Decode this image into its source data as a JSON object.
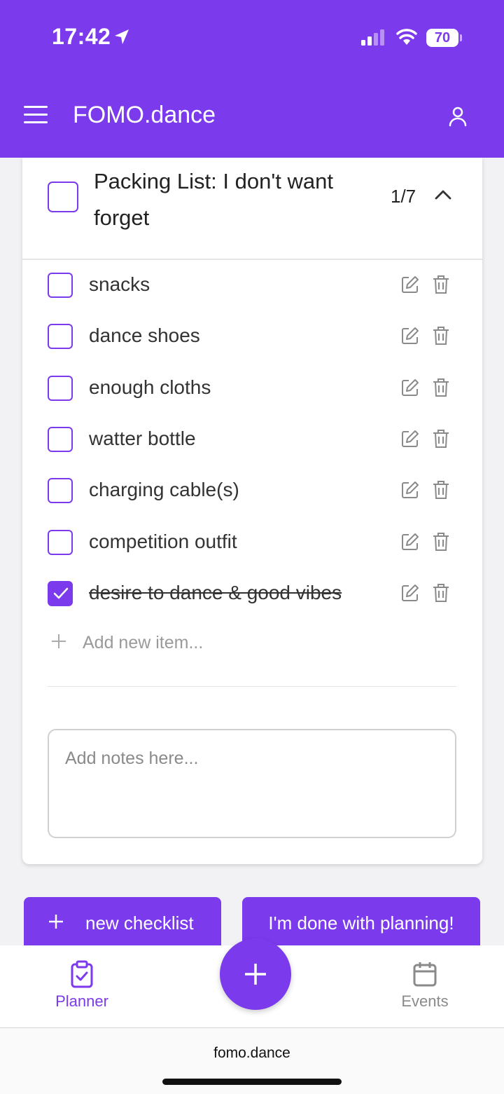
{
  "status_bar": {
    "time": "17:42",
    "battery": "70",
    "icons": [
      "location-arrow-icon",
      "cellular-signal-icon",
      "wifi-icon",
      "battery-icon"
    ]
  },
  "header": {
    "title": "FOMO.dance",
    "menu_icon": "hamburger-menu-icon",
    "profile_icon": "user-icon"
  },
  "checklist": {
    "title": "Packing List: I don't want forget",
    "count": "1/7",
    "collapse_icon": "chevron-up-icon",
    "items": [
      {
        "label": "snacks",
        "checked": false
      },
      {
        "label": "dance shoes",
        "checked": false
      },
      {
        "label": "enough cloths",
        "checked": false
      },
      {
        "label": "watter bottle",
        "checked": false
      },
      {
        "label": "charging cable(s)",
        "checked": false
      },
      {
        "label": "competition outfit",
        "checked": false
      },
      {
        "label": "desire to dance & good vibes",
        "checked": true
      }
    ],
    "add_item_placeholder": "Add new item...",
    "notes_placeholder": "Add notes here..."
  },
  "actions": {
    "new_checklist": "new checklist",
    "done_planning": "I'm done with planning!"
  },
  "bottom_nav": {
    "planner": "Planner",
    "events": "Events",
    "fab_icon": "plus-icon"
  },
  "browser": {
    "url": "fomo.dance"
  },
  "colors": {
    "accent": "#7c3aed",
    "text": "#222222",
    "muted": "#8a8a8a"
  }
}
